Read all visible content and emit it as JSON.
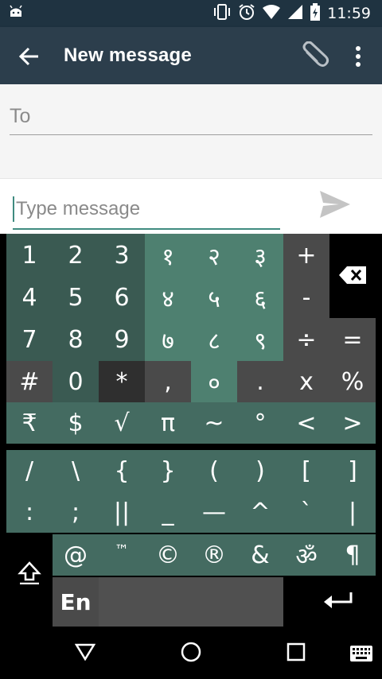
{
  "status_bar": {
    "time": "11:59",
    "icons": [
      "android-icon",
      "vibrate-icon",
      "alarm-icon",
      "wifi-icon",
      "signal-icon",
      "battery-charging-icon"
    ]
  },
  "app_bar": {
    "title": "New message",
    "icons": [
      "back-arrow-icon",
      "paperclip-icon",
      "more-vert-icon"
    ]
  },
  "compose": {
    "to_placeholder": "To",
    "message_placeholder": "Type message"
  },
  "keyboard": {
    "rows": [
      [
        "1",
        "2",
        "3",
        "१",
        "२",
        "३",
        "+"
      ],
      [
        "4",
        "5",
        "6",
        "४",
        "५",
        "६",
        "-"
      ],
      [
        "7",
        "8",
        "9",
        "७",
        "८",
        "९",
        "÷",
        "="
      ],
      [
        "#",
        "0",
        "*",
        ",",
        "०",
        ".",
        "x",
        "%"
      ],
      [
        "₹",
        "$",
        "√",
        "π",
        "~",
        "°",
        "<",
        ">"
      ],
      [
        "/",
        "\\",
        "{",
        "}",
        "(",
        ")",
        "[",
        "]"
      ],
      [
        ":",
        ";",
        "||",
        "_",
        "—",
        "^",
        "`",
        "|"
      ],
      [
        "@",
        "™",
        "©",
        "®",
        "&",
        "ॐ",
        "¶"
      ]
    ],
    "language_key": "En",
    "backspace_icon": "backspace-icon",
    "shift_icon": "shift-icon",
    "enter_icon": "enter-icon"
  },
  "nav_bar": {
    "icons": [
      "back-triangle-icon",
      "home-circle-icon",
      "recents-square-icon",
      "keyboard-icon"
    ]
  },
  "colors": {
    "status_bar": "#1f3341",
    "app_bar": "#2c3e4c",
    "accent": "#3f8b80",
    "key_dark_green": "#3a5a52",
    "key_light_green": "#4e8070",
    "key_gray": "#4a4a4a"
  }
}
